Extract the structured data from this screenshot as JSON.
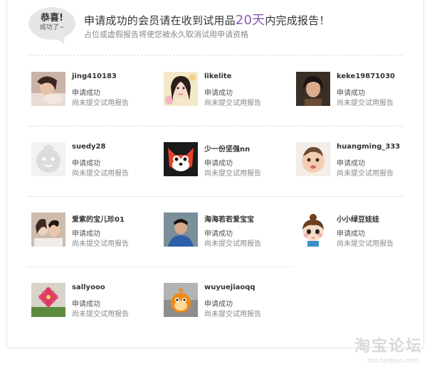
{
  "header": {
    "badge_line1": "恭喜!",
    "badge_line2": "成功了~",
    "headline_before": "申请成功的会员请在收到试用品",
    "headline_highlight": "20天",
    "headline_after": "内完成报告！",
    "subline": "占位或虚假报告将使您被永久取消试用申请资格",
    "highlight_color": "#8a5bb4"
  },
  "members": [
    {
      "name": "jing410183",
      "status": "申请成功",
      "report": "尚未提交试用报告",
      "avatar": "photo-woman-bed"
    },
    {
      "name": "likelite",
      "status": "申请成功",
      "report": "尚未提交试用报告",
      "avatar": "photo-girl-flowers"
    },
    {
      "name": "keke19871030",
      "status": "申请成功",
      "report": "尚未提交试用报告",
      "avatar": "photo-woman-dark"
    },
    {
      "name": "suedy28",
      "status": "申请成功",
      "report": "尚未提交试用报告",
      "avatar": "default-avatar-face"
    },
    {
      "name": "少一份坚强nn",
      "status": "申请成功",
      "report": "尚未提交试用报告",
      "avatar": "cartoon-fox"
    },
    {
      "name": "huangming_333",
      "status": "申请成功",
      "report": "尚未提交试用报告",
      "avatar": "photo-baby"
    },
    {
      "name": "爱紫的宝儿珍01",
      "status": "申请成功",
      "report": "尚未提交试用报告",
      "avatar": "photo-couple"
    },
    {
      "name": "海海若若爱宝宝",
      "status": "申请成功",
      "report": "尚未提交试用报告",
      "avatar": "photo-man-blue"
    },
    {
      "name": "小小绿豆娃娃",
      "status": "申请成功",
      "report": "尚未提交试用报告",
      "avatar": "cartoon-doll"
    },
    {
      "name": "sallyooo",
      "status": "申请成功",
      "report": "尚未提交试用报告",
      "avatar": "photo-pink-flower"
    },
    {
      "name": "wuyuejiaoqq",
      "status": "申请成功",
      "report": "尚未提交试用报告",
      "avatar": "cartoon-orange-character"
    }
  ],
  "watermark": {
    "text": "淘宝论坛",
    "url": "bbs.taobao.com"
  }
}
